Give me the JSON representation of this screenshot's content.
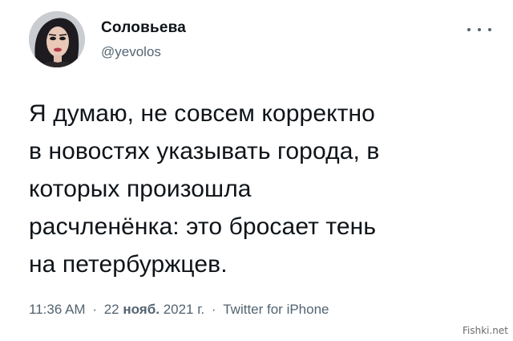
{
  "author": {
    "display_name": "Соловьева",
    "handle": "@yevolos",
    "avatar_icon": "avatar-portrait"
  },
  "more_icon": "more-horizontal-icon",
  "tweet": {
    "lines": [
      "Я думаю, не совсем корректно",
      "в новостях указывать города, в",
      "которых произошла",
      "расчленёнка: это бросает тень",
      "на петербуржцев."
    ]
  },
  "meta": {
    "time": "11:36 AM",
    "separator": "·",
    "date_prefix": "22",
    "date_month": "нояб.",
    "date_suffix": "2021 г.",
    "source": "Twitter for iPhone"
  },
  "watermark": "Fishki.net",
  "colors": {
    "text": "#0f1419",
    "secondary": "#536471",
    "background": "#ffffff"
  }
}
